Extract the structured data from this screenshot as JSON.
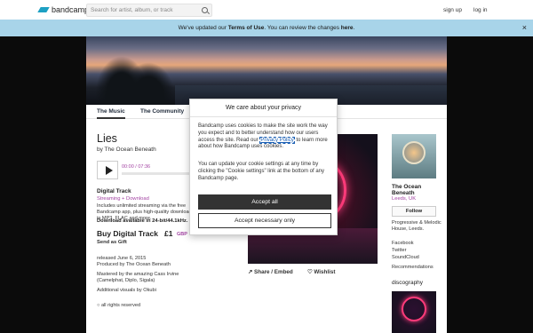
{
  "header": {
    "logo_text": "bandcamp",
    "search_placeholder": "Search for artist, album, or track",
    "signup": "sign up",
    "login": "log in"
  },
  "banner": {
    "prefix": "We've updated our ",
    "terms": "Terms of Use",
    "middle": ". You can review the changes ",
    "here": "here",
    "suffix": ".",
    "close": "×"
  },
  "tabs": [
    "The Music",
    "The Community"
  ],
  "track": {
    "title": "Lies",
    "byline": "by The Ocean Beneath",
    "time": "00:00 / 07:36",
    "progress": 0,
    "format": "Digital Track",
    "stream": "Streaming + Download",
    "includes": "Includes unlimited streaming via the free Bandcamp app, plus high-quality download in MP3, FLAC and more.",
    "download_note": "Download available in 24-bit/44.1kHz.",
    "buy": "Buy Digital Track",
    "price": "£1",
    "currency": "GBP",
    "gift": "Send as Gift",
    "released": "released June 6, 2015",
    "produced": "Produced by The Ocean Beneath",
    "mastered": "Mastered by the amazing Cass Irvine (Camelphat, Diplo, Sigala)",
    "visuals": "Additional visuals by Okubi",
    "rights": "all rights reserved",
    "share": "Share / Embed",
    "wishlist": "Wishlist"
  },
  "artist": {
    "name": "The Ocean Beneath",
    "location": "Leeds, UK",
    "follow": "Follow",
    "genre": "Progressive & Melodic House, Leeds.",
    "links": [
      "Facebook",
      "Twitter",
      "SoundCloud"
    ],
    "recommendations": "Recommendations",
    "discography": "discography"
  },
  "cookie_modal": {
    "title": "We care about your privacy",
    "p1_before": "Bandcamp uses cookies to make the site work the way you expect and to better understand how our users access the site. Read our ",
    "policy_link": "Privacy Policy",
    "p1_after": " to learn more about how Bandcamp uses cookies.",
    "p2": "You can update your cookie settings at any time by clicking the \"Cookie settings\" link at the bottom of any Bandcamp page.",
    "accept_all": "Accept all",
    "accept_necessary": "Accept necessary only"
  }
}
